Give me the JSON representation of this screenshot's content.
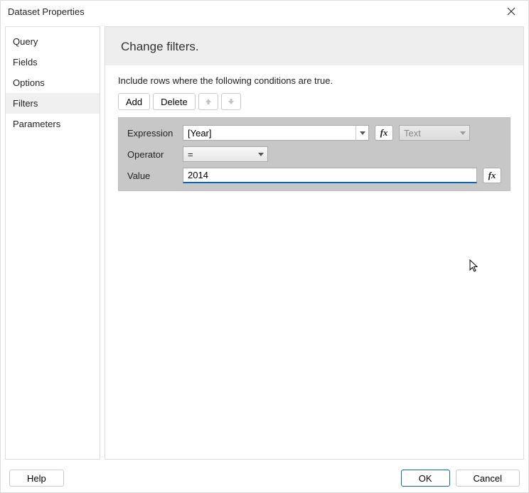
{
  "title": "Dataset Properties",
  "sidebar": {
    "items": [
      {
        "label": "Query"
      },
      {
        "label": "Fields"
      },
      {
        "label": "Options"
      },
      {
        "label": "Filters"
      },
      {
        "label": "Parameters"
      }
    ],
    "selectedIndex": 3
  },
  "main": {
    "header": "Change filters.",
    "instruction": "Include rows where the following conditions are true.",
    "toolbar": {
      "add": "Add",
      "delete": "Delete"
    },
    "filter": {
      "expressionLabel": "Expression",
      "expressionValue": "[Year]",
      "typeValue": "Text",
      "operatorLabel": "Operator",
      "operatorValue": "=",
      "valueLabel": "Value",
      "valueValue": "2014"
    }
  },
  "footer": {
    "help": "Help",
    "ok": "OK",
    "cancel": "Cancel"
  }
}
